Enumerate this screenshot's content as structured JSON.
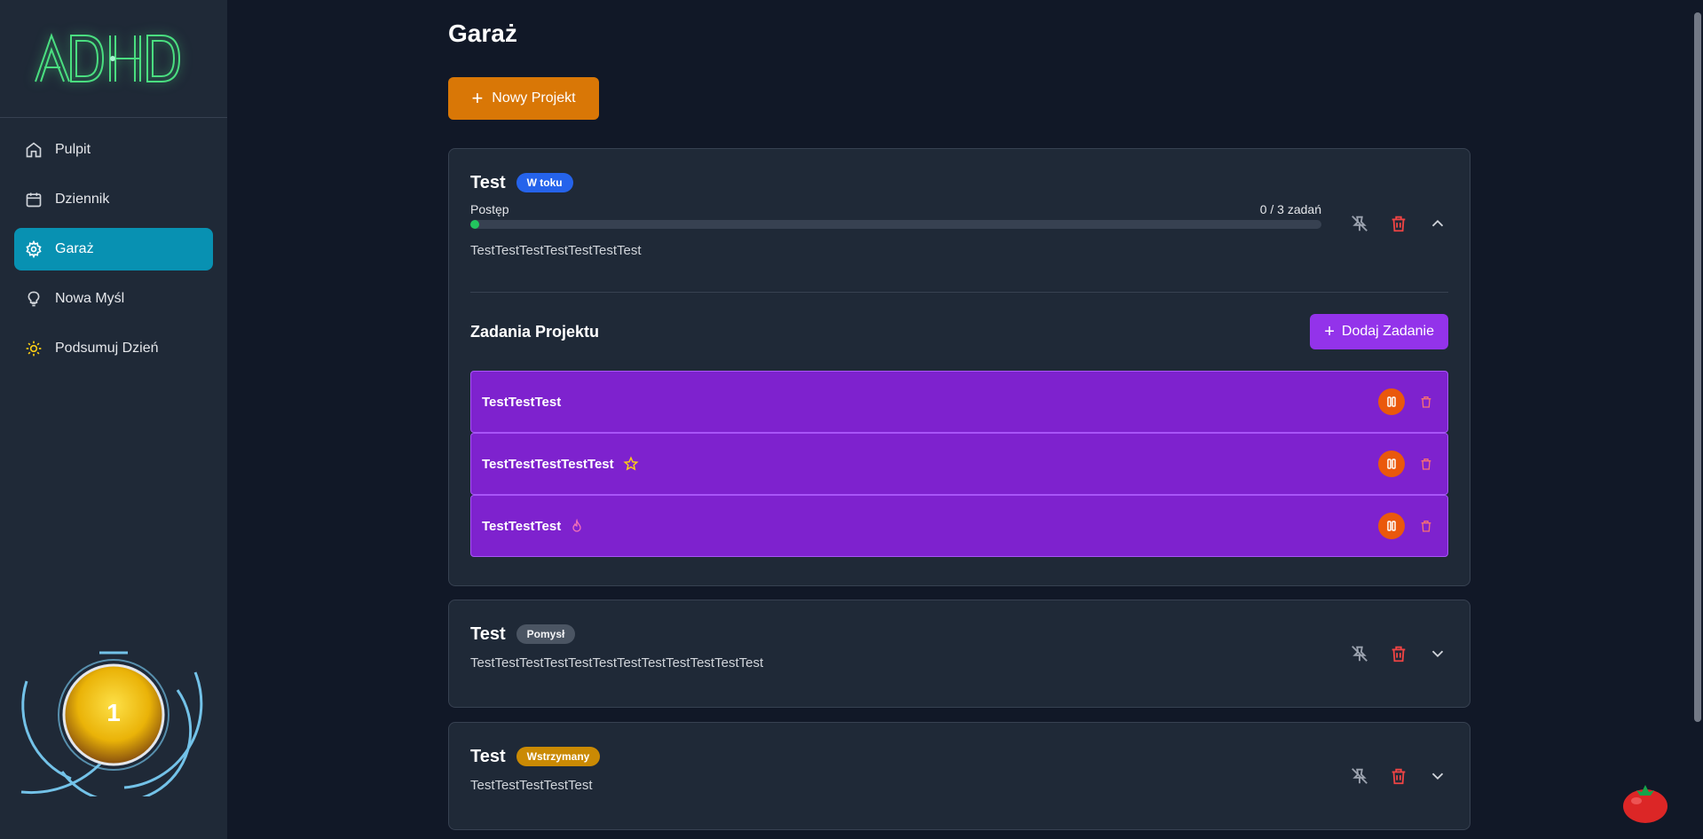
{
  "sidebar": {
    "logo_text": "ADHD",
    "items": [
      {
        "label": "Pulpit",
        "icon": "home-icon",
        "active": false
      },
      {
        "label": "Dziennik",
        "icon": "calendar-icon",
        "active": false
      },
      {
        "label": "Garaż",
        "icon": "gear-icon",
        "active": true
      },
      {
        "label": "Nowa Myśl",
        "icon": "lightbulb-icon",
        "active": false
      },
      {
        "label": "Podsumuj Dzień",
        "icon": "sun-icon",
        "active": false
      }
    ],
    "level": "1"
  },
  "main": {
    "title": "Garaż",
    "new_project_label": "Nowy Projekt",
    "projects": [
      {
        "title": "Test",
        "status": "W toku",
        "status_color": "#2563eb",
        "progress_label": "Postęp",
        "progress_count": "0 / 3 zadań",
        "progress_fraction": 0.01,
        "description": "TestTestTestTestTestTestTest",
        "expanded": true,
        "tasks_title": "Zadania Projektu",
        "add_task_label": "Dodaj Zadanie",
        "tasks": [
          {
            "name": "TestTestTest",
            "marker": ""
          },
          {
            "name": "TestTestTestTestTest",
            "marker": "star-icon"
          },
          {
            "name": "TestTestTest",
            "marker": "flame-icon"
          }
        ]
      },
      {
        "title": "Test",
        "status": "Pomysł",
        "status_color": "#4b5563",
        "description": "TestTestTestTestTestTestTestTestTestTestTestTest",
        "expanded": false
      },
      {
        "title": "Test",
        "status": "Wstrzymany",
        "status_color": "#ca8a04",
        "description": "TestTestTestTestTest",
        "expanded": false
      }
    ]
  },
  "colors": {
    "background": "#111827",
    "sidebar": "#1f2937",
    "active_nav": "#0891b2",
    "accent_orange": "#d97706",
    "accent_purple": "#9333ea",
    "task_bg": "#7e22ce",
    "delete_red": "#ef4444"
  }
}
